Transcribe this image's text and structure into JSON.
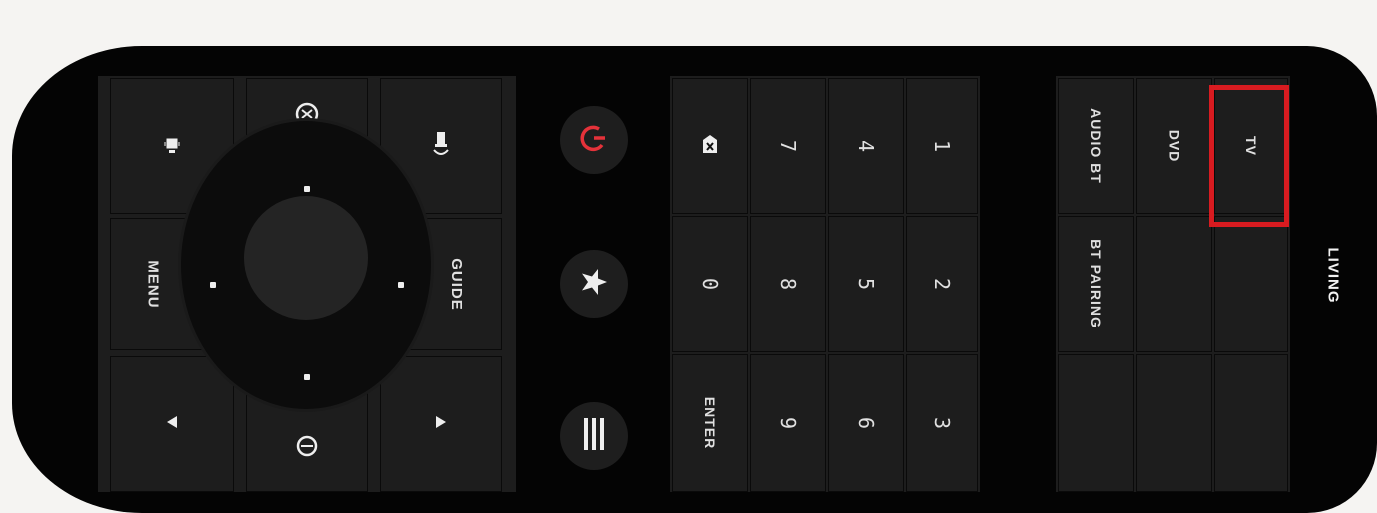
{
  "window": {
    "room_label": "LIVING",
    "highlight_color": "#d81b20"
  },
  "sources": {
    "items": [
      {
        "label": "TV",
        "selected": true
      },
      {
        "label": "DVD",
        "selected": false
      },
      {
        "label": "AUDIO BT",
        "selected": false
      },
      {
        "label": "BT PAIRING",
        "selected": false
      }
    ]
  },
  "keypad": {
    "keys": [
      "1",
      "2",
      "3",
      "4",
      "5",
      "6",
      "7",
      "8",
      "9",
      "0",
      "ENTER"
    ]
  },
  "center": {
    "power_color": "#e5323a",
    "buttons": [
      "power-icon",
      "star-icon",
      "menu-lines-icon"
    ]
  },
  "nav": {
    "menu_label": "MENU",
    "guide_label": "GUIDE",
    "icons": [
      "bell-icon",
      "radio-icon",
      "bell-sound-icon",
      "play-icon",
      "rewind-icon",
      "clock-icon"
    ]
  }
}
